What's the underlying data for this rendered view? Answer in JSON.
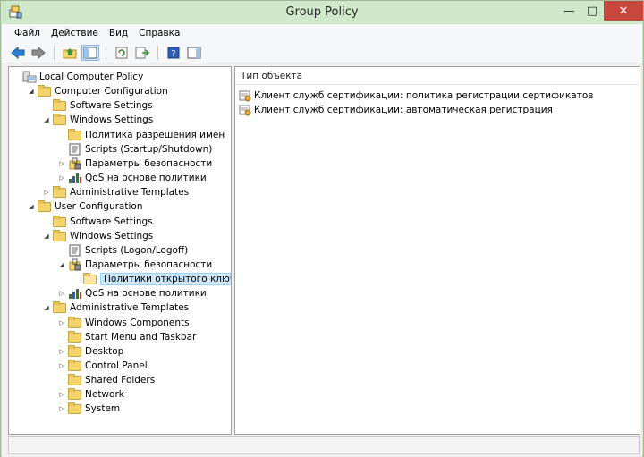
{
  "window": {
    "title": "Group Policy"
  },
  "menu": [
    "Файл",
    "Действие",
    "Вид",
    "Справка"
  ],
  "tree": [
    {
      "label": "Local Computer Policy",
      "icon": "computer-policy-icon",
      "depth": 0,
      "twisty": "none"
    },
    {
      "label": "Computer Configuration",
      "icon": "folder-icon",
      "depth": 1,
      "twisty": "expanded"
    },
    {
      "label": "Software Settings",
      "icon": "folder-icon",
      "depth": 2,
      "twisty": "none"
    },
    {
      "label": "Windows Settings",
      "icon": "folder-icon",
      "depth": 2,
      "twisty": "expanded"
    },
    {
      "label": "Политика разрешения имен",
      "icon": "folder-icon",
      "depth": 3,
      "twisty": "none"
    },
    {
      "label": "Scripts (Startup/Shutdown)",
      "icon": "script-icon",
      "depth": 3,
      "twisty": "none"
    },
    {
      "label": "Параметры безопасности",
      "icon": "security-icon",
      "depth": 3,
      "twisty": "collapsed"
    },
    {
      "label": "QoS на основе политики",
      "icon": "qos-chart-icon",
      "depth": 3,
      "twisty": "collapsed"
    },
    {
      "label": "Administrative Templates",
      "icon": "folder-icon",
      "depth": 2,
      "twisty": "collapsed"
    },
    {
      "label": "User Configuration",
      "icon": "folder-icon",
      "depth": 1,
      "twisty": "expanded"
    },
    {
      "label": "Software Settings",
      "icon": "folder-icon",
      "depth": 2,
      "twisty": "none"
    },
    {
      "label": "Windows Settings",
      "icon": "folder-icon",
      "depth": 2,
      "twisty": "expanded"
    },
    {
      "label": "Scripts (Logon/Logoff)",
      "icon": "script-icon",
      "depth": 3,
      "twisty": "none"
    },
    {
      "label": "Параметры безопасности",
      "icon": "security-icon",
      "depth": 3,
      "twisty": "expanded"
    },
    {
      "label": "Политики открытого ключа",
      "icon": "folder-open-icon",
      "depth": 4,
      "twisty": "none",
      "selected": true
    },
    {
      "label": "QoS на основе политики",
      "icon": "qos-chart-icon",
      "depth": 3,
      "twisty": "collapsed"
    },
    {
      "label": "Administrative Templates",
      "icon": "folder-icon",
      "depth": 2,
      "twisty": "expanded"
    },
    {
      "label": "Windows Components",
      "icon": "folder-icon",
      "depth": 3,
      "twisty": "collapsed"
    },
    {
      "label": "Start Menu and Taskbar",
      "icon": "folder-icon",
      "depth": 3,
      "twisty": "none"
    },
    {
      "label": "Desktop",
      "icon": "folder-icon",
      "depth": 3,
      "twisty": "collapsed"
    },
    {
      "label": "Control Panel",
      "icon": "folder-icon",
      "depth": 3,
      "twisty": "collapsed"
    },
    {
      "label": "Shared Folders",
      "icon": "folder-icon",
      "depth": 3,
      "twisty": "none"
    },
    {
      "label": "Network",
      "icon": "folder-icon",
      "depth": 3,
      "twisty": "collapsed"
    },
    {
      "label": "System",
      "icon": "folder-icon",
      "depth": 3,
      "twisty": "collapsed"
    }
  ],
  "list": {
    "column": "Тип объекта",
    "items": [
      "Клиент служб сертификации: политика регистрации сертификатов",
      "Клиент служб сертификации: автоматическая регистрация"
    ]
  },
  "colors": {
    "titlebar": "#cfe8c9",
    "close": "#c7463d",
    "selection": "#cce8ff"
  }
}
